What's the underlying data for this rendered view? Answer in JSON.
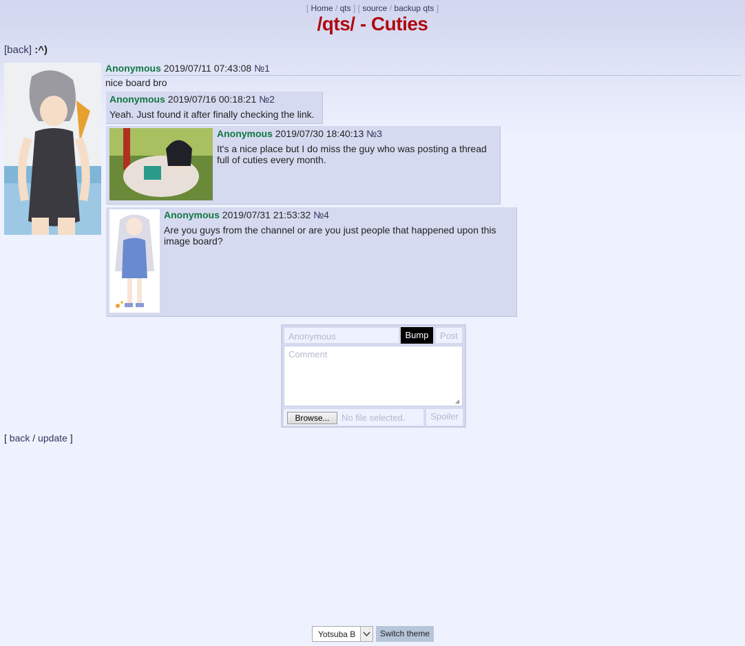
{
  "topnav": {
    "open1": "[",
    "home": "Home",
    "sep1": "/",
    "qts": "qts",
    "close1": "]",
    "open2": "[",
    "source": "source",
    "sep2": "/",
    "backup": "backup qts",
    "close2": "]"
  },
  "board_title": "/qts/ - Cuties",
  "backline": {
    "back": "[back]",
    "subject": ":^)"
  },
  "op": {
    "name": "Anonymous",
    "date": "2019/07/11 07:43:08",
    "no": "№1",
    "body": "nice board bro"
  },
  "replies": [
    {
      "name": "Anonymous",
      "date": "2019/07/16 00:18:21",
      "no": "№2",
      "body": "Yeah. Just found it after finally checking the link."
    },
    {
      "name": "Anonymous",
      "date": "2019/07/30 18:40:13",
      "no": "№3",
      "body": "It's a nice place but I do miss the guy who was posting a thread full of cuties every month."
    },
    {
      "name": "Anonymous",
      "date": "2019/07/31 21:53:32",
      "no": "№4",
      "body": "Are you guys from the channel or are you just people that happened upon this image board?"
    }
  ],
  "form": {
    "name_placeholder": "Anonymous",
    "bump_label": "Bump",
    "post_label": "Post",
    "comment_placeholder": "Comment",
    "browse_label": "Browse...",
    "no_file": "No file selected.",
    "spoiler_label": "Spoiler"
  },
  "bottomnav": {
    "open": "[",
    "back": "back",
    "sep": "/",
    "update": "update",
    "close": "]"
  },
  "theme": {
    "selected": "Yotsuba B",
    "switch_label": "Switch theme"
  }
}
